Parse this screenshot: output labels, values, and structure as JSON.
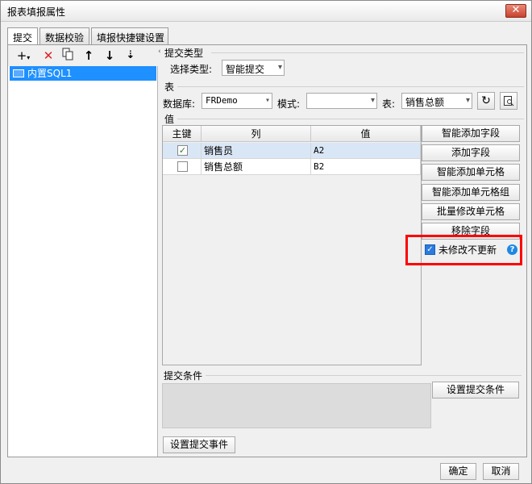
{
  "window": {
    "title": "报表填报属性",
    "close_glyph": "✕"
  },
  "tabs": [
    {
      "label": "提交",
      "active": true
    },
    {
      "label": "数据校验",
      "active": false
    },
    {
      "label": "填报快捷键设置",
      "active": false
    }
  ],
  "toolbar": {
    "add_icon": "plus-icon",
    "delete_icon": "delete-icon",
    "copy_icon": "copy-icon",
    "up_icon": "arrow-up-icon",
    "down_icon": "arrow-down-icon",
    "sort_icon": "sort-icon"
  },
  "datasource_list": [
    {
      "label": "内置SQL1",
      "selected": true
    }
  ],
  "submit_type": {
    "section": "提交类型",
    "label": "选择类型:",
    "value": "智能提交"
  },
  "table_section": {
    "section": "表",
    "db_label": "数据库:",
    "db_value": "FRDemo",
    "mode_label": "模式:",
    "mode_value": "",
    "table_label": "表:",
    "table_value": "销售总额"
  },
  "values_section": {
    "section": "值",
    "headers": {
      "key": "主键",
      "column": "列",
      "value": "值"
    },
    "rows": [
      {
        "key_checked": true,
        "column": "销售员",
        "value": "A2"
      },
      {
        "key_checked": false,
        "column": "销售总额",
        "value": "B2"
      }
    ]
  },
  "side_buttons": {
    "smart_add_field": "智能添加字段",
    "add_field": "添加字段",
    "smart_add_cell": "智能添加单元格",
    "smart_add_cell_group": "智能添加单元格组",
    "batch_modify_cell": "批量修改单元格",
    "remove_field": "移除字段"
  },
  "unmodified_no_update": {
    "label": "未修改不更新",
    "checked": true
  },
  "submit_condition": {
    "section": "提交条件",
    "button": "设置提交条件"
  },
  "submit_event_button": "设置提交事件",
  "footer": {
    "ok": "确定",
    "cancel": "取消"
  },
  "colors": {
    "selection": "#1e90ff",
    "highlight_border": "#ff0000",
    "help": "#1e88e5"
  }
}
